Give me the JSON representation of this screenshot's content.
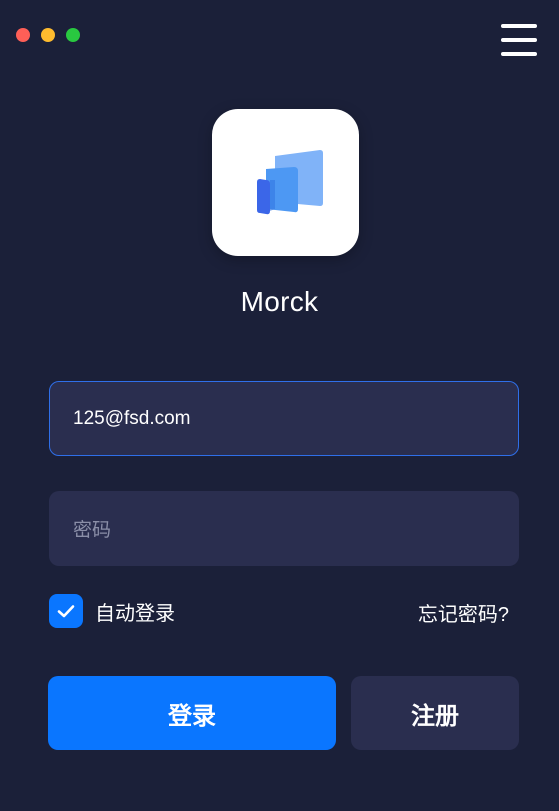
{
  "window": {
    "controls": [
      {
        "name": "close",
        "color": "#fe5f57"
      },
      {
        "name": "minimize",
        "color": "#febb2e"
      },
      {
        "name": "zoom",
        "color": "#29c840"
      }
    ],
    "menu_icon": "hamburger-menu-icon"
  },
  "app": {
    "name": "Morck",
    "logo_icon": "stacked-windows-logo-icon"
  },
  "form": {
    "email_value": "125@fsd.com",
    "password_placeholder": "密码",
    "remember_label": "自动登录",
    "remember_checked": true,
    "forgot_label": "忘记密码?",
    "login_label": "登录",
    "register_label": "注册"
  },
  "colors": {
    "background": "#1b2039",
    "field": "#2a2e4f",
    "accent": "#0a76ff",
    "active_border": "#2f6fe9"
  }
}
